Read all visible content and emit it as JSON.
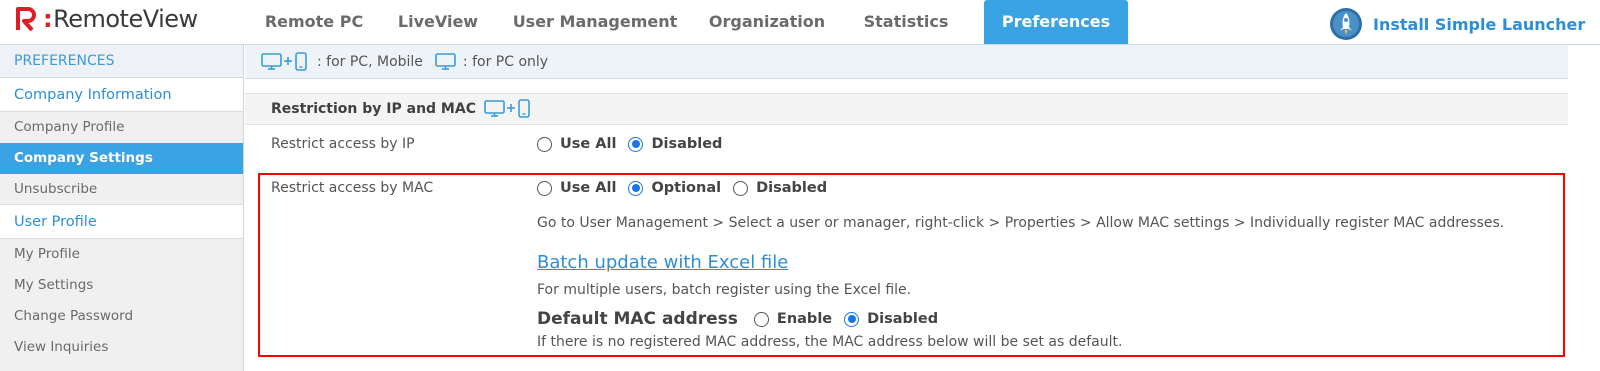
{
  "header": {
    "logo_text": "RemoteView",
    "tabs": [
      {
        "label": "Remote PC"
      },
      {
        "label": "LiveView"
      },
      {
        "label": "User Management"
      },
      {
        "label": "Organization"
      },
      {
        "label": "Statistics"
      },
      {
        "label": "Preferences",
        "active": true
      }
    ],
    "launcher_label": "Install Simple Launcher"
  },
  "sidebar": {
    "heading": "PREFERENCES",
    "company_section": "Company Information",
    "company_items": [
      "Company Profile",
      "Company Settings",
      "Unsubscribe"
    ],
    "active_item": "Company Settings",
    "user_section": "User Profile",
    "user_items": [
      "My Profile",
      "My Settings",
      "Change Password",
      "View Inquiries"
    ]
  },
  "legend": {
    "pc_mobile": ": for PC, Mobile",
    "pc_only": ": for PC only"
  },
  "section": {
    "title": "Restriction by IP and MAC"
  },
  "ip_restriction": {
    "label": "Restrict access by IP",
    "options": [
      "Use All",
      "Disabled"
    ],
    "selected": "Disabled"
  },
  "mac_restriction": {
    "label": "Restrict access by MAC",
    "options": [
      "Use All",
      "Optional",
      "Disabled"
    ],
    "selected": "Optional",
    "instructions": "Go to User Management > Select a user or manager, right-click > Properties > Allow MAC settings > Individually register MAC addresses.",
    "batch_link": "Batch update with Excel file",
    "batch_desc": "For multiple users, batch register using the Excel file.",
    "default_mac": {
      "title": "Default MAC address",
      "options": [
        "Enable",
        "Disabled"
      ],
      "selected": "Disabled",
      "desc": "If there is no registered MAC address, the MAC address below will be set as default."
    }
  },
  "colors": {
    "accent": "#3aa3e3",
    "link": "#2b8fd8",
    "highlight_border": "#ff0000",
    "logo_red": "#e11c24"
  }
}
